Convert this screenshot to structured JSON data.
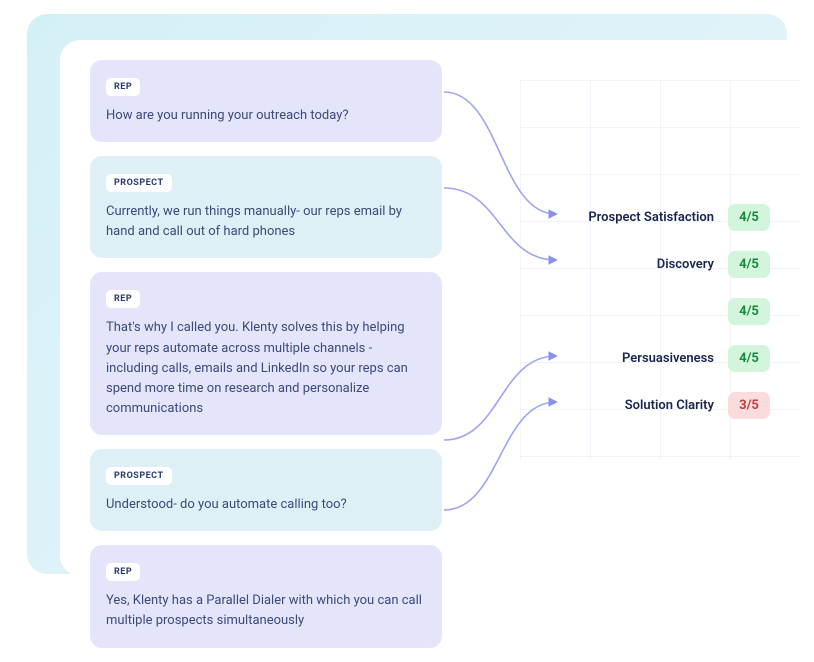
{
  "roles": {
    "rep": "REP",
    "prospect": "PROSPECT"
  },
  "chat": [
    {
      "speaker": "rep",
      "text": "How are you running your outreach today?"
    },
    {
      "speaker": "prospect",
      "text": "Currently, we run things manually- our reps email by hand and call out of hard phones"
    },
    {
      "speaker": "rep",
      "text": "That's why I called you. Klenty solves this by helping your reps automate across multiple channels - including calls, emails and LinkedIn so your reps can spend more time on research and personalize communications"
    },
    {
      "speaker": "prospect",
      "text": "Understood- do you automate calling too?"
    },
    {
      "speaker": "rep",
      "text": "Yes, Klenty has a Parallel Dialer with which you can call multiple prospects simultaneously"
    }
  ],
  "metrics": [
    {
      "label": "Prospect Satisfaction",
      "score": "4/5",
      "status": "green"
    },
    {
      "label": "Discovery",
      "score": "4/5",
      "status": "green"
    },
    {
      "label": "",
      "score": "4/5",
      "status": "green"
    },
    {
      "label": "Persuasiveness",
      "score": "4/5",
      "status": "green"
    },
    {
      "label": "Solution Clarity",
      "score": "3/5",
      "status": "red"
    }
  ]
}
